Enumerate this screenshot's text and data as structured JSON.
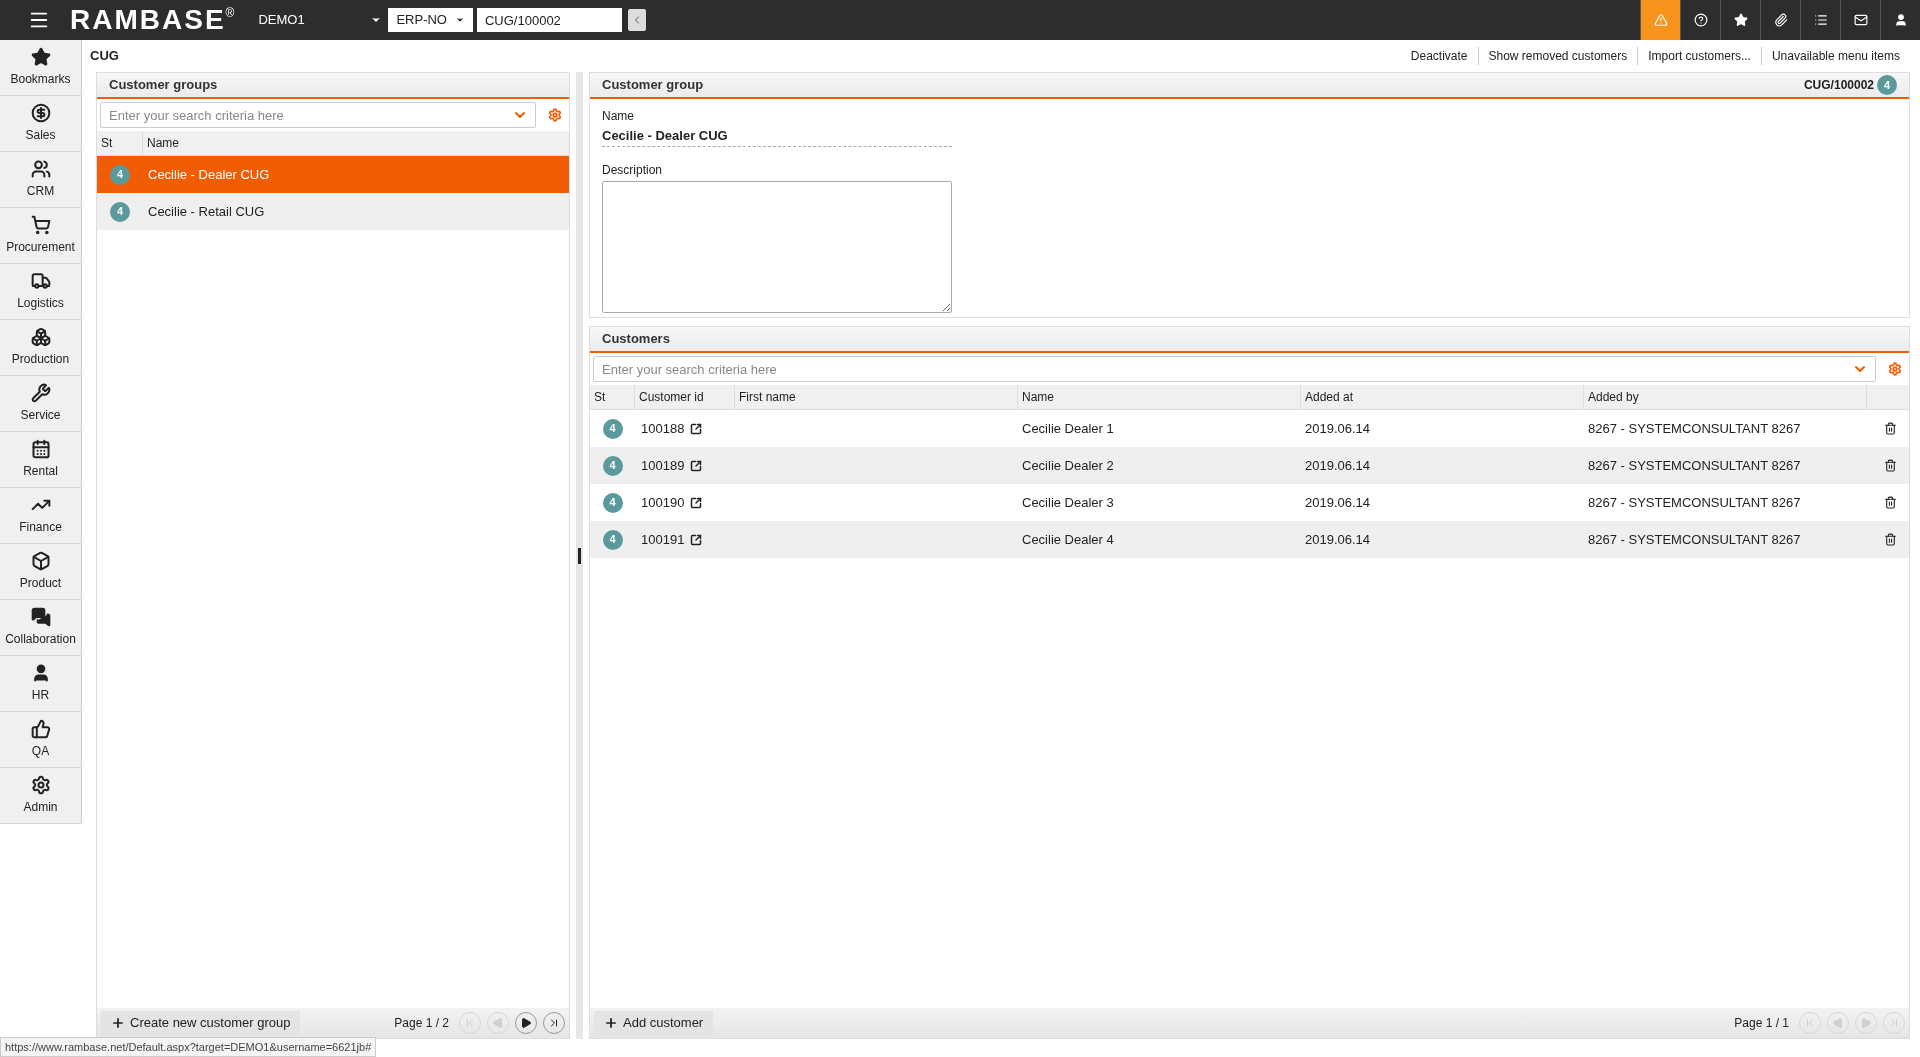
{
  "topbar": {
    "logo": "RAMBASE",
    "logo_mark": "®",
    "company": "DEMO1",
    "region": "ERP-NO",
    "object_field": "CUG/100002",
    "icons": [
      {
        "kind": "alert",
        "highlighted": true
      },
      {
        "kind": "help",
        "highlighted": false
      },
      {
        "kind": "star",
        "highlighted": false
      },
      {
        "kind": "clip",
        "highlighted": false
      },
      {
        "kind": "list",
        "highlighted": false
      },
      {
        "kind": "mail",
        "highlighted": false
      },
      {
        "kind": "user",
        "highlighted": false
      }
    ]
  },
  "sidebar": {
    "items": [
      {
        "kind": "star",
        "label": "Bookmarks"
      },
      {
        "kind": "money",
        "label": "Sales"
      },
      {
        "kind": "users",
        "label": "CRM"
      },
      {
        "kind": "cart",
        "label": "Procurement"
      },
      {
        "kind": "truck",
        "label": "Logistics"
      },
      {
        "kind": "boxes",
        "label": "Production"
      },
      {
        "kind": "wrench",
        "label": "Service"
      },
      {
        "kind": "calendar",
        "label": "Rental"
      },
      {
        "kind": "chart",
        "label": "Finance"
      },
      {
        "kind": "box",
        "label": "Product"
      },
      {
        "kind": "chat",
        "label": "Collaboration"
      },
      {
        "kind": "user",
        "label": "HR"
      },
      {
        "kind": "thumb",
        "label": "QA"
      },
      {
        "kind": "gear",
        "label": "Admin"
      }
    ]
  },
  "page_title": "CUG",
  "actions": [
    "Deactivate",
    "Show removed customers",
    "Import customers...",
    "Unavailable menu items"
  ],
  "customer_groups": {
    "title": "Customer groups",
    "search": {
      "placeholder": "Enter your search criteria here"
    },
    "columns": [
      "St",
      "Name"
    ],
    "rows": [
      {
        "status": "4",
        "name": "Cecilie - Dealer CUG",
        "selected": true
      },
      {
        "status": "4",
        "name": "Cecilie - Retail CUG",
        "selected": false
      }
    ],
    "create_button": "Create new customer group",
    "page": "Page 1 / 2",
    "pager": [
      {
        "kind": "first",
        "disabled": true
      },
      {
        "kind": "prev",
        "disabled": true
      },
      {
        "kind": "next",
        "disabled": false
      },
      {
        "kind": "last",
        "disabled": false
      }
    ]
  },
  "customer_group": {
    "title": "Customer group",
    "id": "CUG/100002",
    "status": "4",
    "fields": [
      {
        "label": "Name",
        "value": "Cecilie - Dealer CUG",
        "kind": "text"
      },
      {
        "label": "Description",
        "kind": "textarea"
      }
    ]
  },
  "customers": {
    "title": "Customers",
    "search": {
      "placeholder": "Enter your search criteria here"
    },
    "columns": [
      "St",
      "Customer id",
      "First name",
      "Name",
      "Added at",
      "Added by"
    ],
    "rows": [
      {
        "status": "4",
        "customer_id": "100188",
        "name": "Cecilie Dealer 1",
        "added_at": "2019.06.14",
        "added_by": "8267 - SYSTEMCONSULTANT 8267"
      },
      {
        "status": "4",
        "customer_id": "100189",
        "name": "Cecilie Dealer 2",
        "added_at": "2019.06.14",
        "added_by": "8267 - SYSTEMCONSULTANT 8267"
      },
      {
        "status": "4",
        "customer_id": "100190",
        "name": "Cecilie Dealer 3",
        "added_at": "2019.06.14",
        "added_by": "8267 - SYSTEMCONSULTANT 8267"
      },
      {
        "status": "4",
        "customer_id": "100191",
        "name": "Cecilie Dealer 4",
        "added_at": "2019.06.14",
        "added_by": "8267 - SYSTEMCONSULTANT 8267"
      }
    ],
    "add_button": "Add customer",
    "page": "Page 1 / 1",
    "pager": [
      {
        "kind": "first",
        "disabled": true
      },
      {
        "kind": "prev",
        "disabled": true
      },
      {
        "kind": "next",
        "disabled": true
      },
      {
        "kind": "last",
        "disabled": true
      }
    ]
  },
  "status_url": "https://www.rambase.net/Default.aspx?target=DEMO1&username=6621jb#"
}
